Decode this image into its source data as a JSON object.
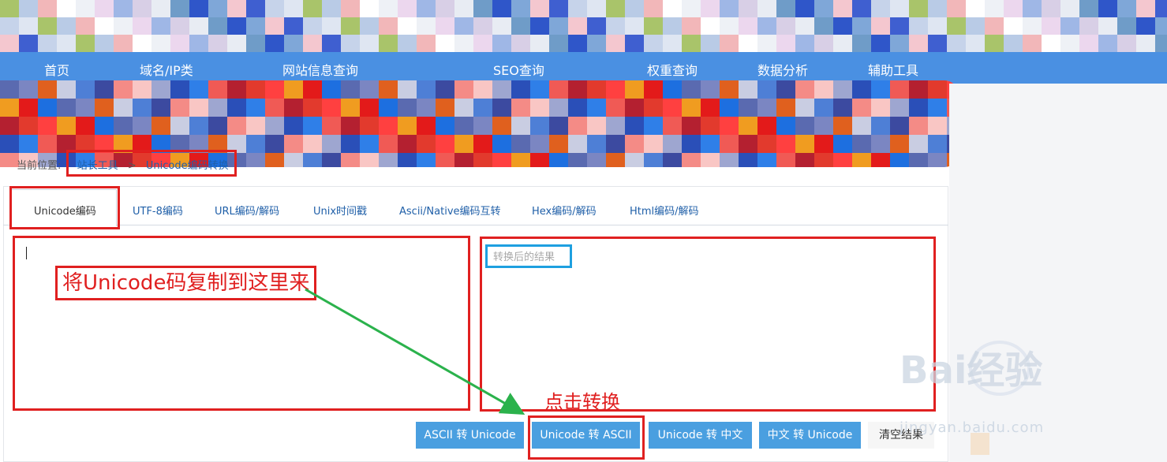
{
  "nav": {
    "items": [
      "首页",
      "域名/IP类",
      "网站信息查询",
      "SEO查询",
      "权重查询",
      "数据分析",
      "辅助工具"
    ]
  },
  "breadcrumb": {
    "prefix": "当前位置:",
    "home": "站长工具",
    "sep": ">",
    "current": "Unicode编码转换"
  },
  "tabs": [
    "Unicode编码",
    "UTF-8编码",
    "URL编码/解码",
    "Unix时间戳",
    "Ascii/Native编码互转",
    "Hex编码/解码",
    "Html编码/解码"
  ],
  "output": {
    "placeholder": "转换后的结果"
  },
  "annotations": {
    "paste_hint": "将Unicode码复制到这里来",
    "click_hint": "点击转换"
  },
  "buttons": {
    "ascii_to_unicode": "ASCII 转 Unicode",
    "unicode_to_ascii": "Unicode 转 ASCII",
    "unicode_to_chinese": "Unicode 转 中文",
    "chinese_to_unicode": "中文 转 Unicode",
    "clear": "清空结果"
  },
  "watermark": {
    "brand": "Bai经验",
    "site": "jingyan.baidu.com"
  },
  "colors": {
    "nav": "#4a90e2",
    "button": "#4a9fe0",
    "highlight": "#e02020",
    "placeholder_box": "#1ea0e0",
    "arrow": "#2bb24c"
  }
}
